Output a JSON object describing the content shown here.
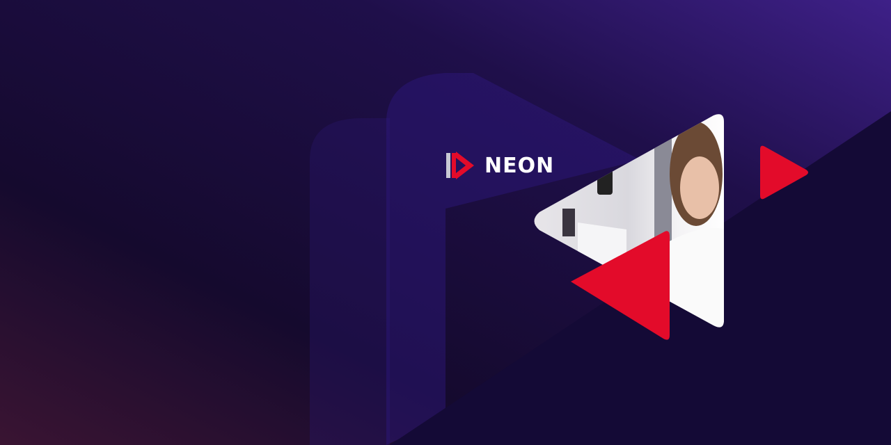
{
  "brand": {
    "name": "NEON",
    "logo_icon": "neon-play-logo-icon"
  },
  "colors": {
    "background_dark": "#120a30",
    "background_purple": "#3a1f80",
    "accent_red": "#e30b2a",
    "glow_maroon": "#4a1530"
  },
  "photo": {
    "subject": "scientist-holding-sample-vial"
  }
}
